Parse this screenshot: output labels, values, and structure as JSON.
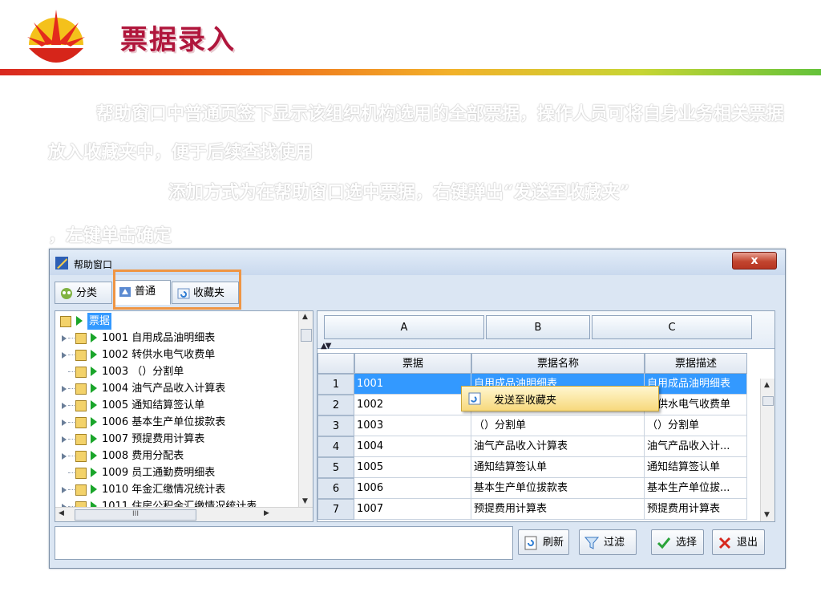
{
  "slide": {
    "title": "票据录入",
    "paragraph1": "帮助窗口中普通页签下显示该组织机构选用的全部票据，操作人员可将自身业务相关票据放入收藏夹中，便于后续查找使用",
    "paragraph2": "添加方式为在帮助窗口选中票据，右键弹出“发送至收藏夹”",
    "paragraph3": "，左键单击确定"
  },
  "window": {
    "title": "帮助窗口",
    "close_label": "x",
    "tabs": [
      {
        "label": "分类"
      },
      {
        "label": "普通"
      },
      {
        "label": "收藏夹"
      }
    ],
    "tree": {
      "root": "票据",
      "items": [
        "1001 自用成品油明细表",
        "1002 转供水电气收费单",
        "1003 （）分割单",
        "1004 油气产品收入计算表",
        "1005 通知结算签认单",
        "1006 基本生产单位拔款表",
        "1007 预提费用计算表",
        "1008 费用分配表",
        "1009 员工通勤费明细表",
        "1010 年金汇缴情况统计表",
        "1011 住房公积金汇缴情况统计表"
      ],
      "hscroll_label": "III"
    },
    "grid": {
      "column_buttons": [
        "A",
        "B",
        "C"
      ],
      "headers": [
        "票据",
        "票据名称",
        "票据描述"
      ],
      "rows": [
        {
          "num": "1",
          "code": "1001",
          "name": "自用成品油明细表",
          "desc": "自用成品油明细表"
        },
        {
          "num": "2",
          "code": "1002",
          "name": "转供水电气收费单",
          "desc": "转供水电气收费单"
        },
        {
          "num": "3",
          "code": "1003",
          "name": "（）分割单",
          "desc": "（）分割单"
        },
        {
          "num": "4",
          "code": "1004",
          "name": "油气产品收入计算表",
          "desc": "油气产品收入计..."
        },
        {
          "num": "5",
          "code": "1005",
          "name": "通知结算签认单",
          "desc": "通知结算签认单"
        },
        {
          "num": "6",
          "code": "1006",
          "name": "基本生产单位拔款表",
          "desc": "基本生产单位拔..."
        },
        {
          "num": "7",
          "code": "1007",
          "name": "预提费用计算表",
          "desc": "预提费用计算表"
        }
      ]
    },
    "context_menu": {
      "item": "发送至收藏夹"
    },
    "footer": {
      "input_value": "",
      "refresh": "刷新",
      "filter": "过滤",
      "select": "选择",
      "exit": "退出"
    }
  },
  "colors": {
    "title": "#b0163c",
    "accent_frame": "#ef9543",
    "selection": "#3399ff"
  }
}
